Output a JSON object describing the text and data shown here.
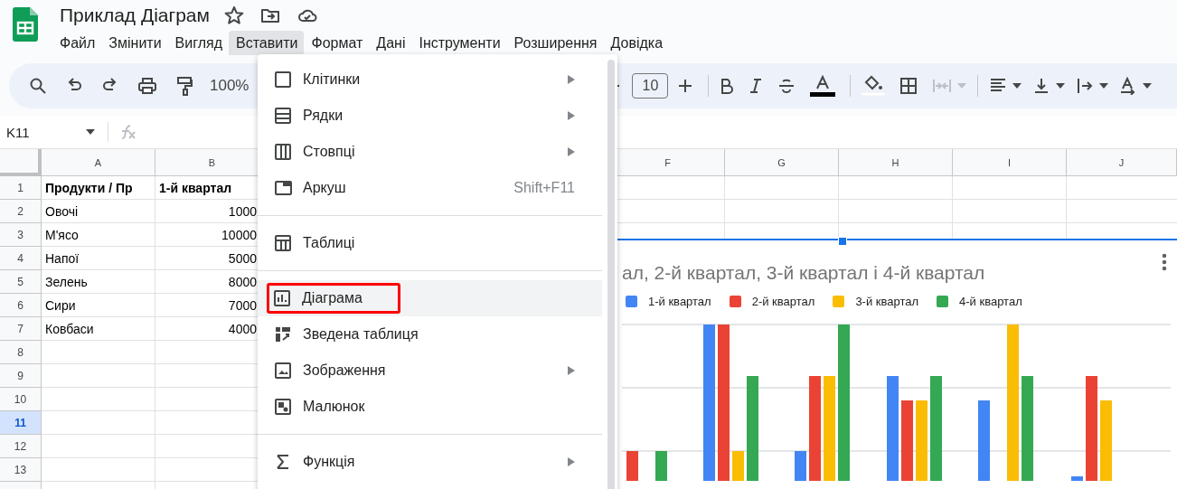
{
  "document": {
    "title": "Приклад Діаграм"
  },
  "menu_bar": [
    {
      "label": "Файл",
      "selected": false
    },
    {
      "label": "Змінити",
      "selected": false
    },
    {
      "label": "Вигляд",
      "selected": false
    },
    {
      "label": "Вставити",
      "selected": true
    },
    {
      "label": "Формат",
      "selected": false
    },
    {
      "label": "Дані",
      "selected": false
    },
    {
      "label": "Інструменти",
      "selected": false
    },
    {
      "label": "Розширення",
      "selected": false
    },
    {
      "label": "Довідка",
      "selected": false
    }
  ],
  "toolbar": {
    "zoom": "100%",
    "font_size": "10",
    "merge_disabled": true
  },
  "formula_bar": {
    "cell_reference": "K11"
  },
  "columns": [
    {
      "label": "A"
    },
    {
      "label": "B"
    },
    {
      "label": "F"
    },
    {
      "label": "G"
    },
    {
      "label": "H"
    },
    {
      "label": "I"
    },
    {
      "label": "J"
    }
  ],
  "rows": [
    {
      "number": "1",
      "selected": false,
      "kind": "header",
      "cells": [
        "Продукти / Пр",
        "1-й квартал"
      ]
    },
    {
      "number": "2",
      "selected": false,
      "kind": "data",
      "cells": [
        "Овочі",
        "1000"
      ]
    },
    {
      "number": "3",
      "selected": false,
      "kind": "data",
      "cells": [
        "М'ясо",
        "10000"
      ]
    },
    {
      "number": "4",
      "selected": false,
      "kind": "data",
      "cells": [
        "Напої",
        "5000"
      ]
    },
    {
      "number": "5",
      "selected": false,
      "kind": "data",
      "cells": [
        "Зелень",
        "8000"
      ]
    },
    {
      "number": "6",
      "selected": false,
      "kind": "data",
      "cells": [
        "Сири",
        "7000"
      ]
    },
    {
      "number": "7",
      "selected": false,
      "kind": "data",
      "cells": [
        "Ковбаси",
        "4000"
      ]
    },
    {
      "number": "8",
      "selected": false,
      "kind": "empty"
    },
    {
      "number": "9",
      "selected": false,
      "kind": "empty"
    },
    {
      "number": "10",
      "selected": false,
      "kind": "empty"
    },
    {
      "number": "11",
      "selected": true,
      "kind": "empty"
    },
    {
      "number": "12",
      "selected": false,
      "kind": "empty"
    },
    {
      "number": "13",
      "selected": false,
      "kind": "empty"
    }
  ],
  "insert_menu": [
    {
      "kind": "item",
      "label": "Клітинки",
      "submenu": true,
      "highlighted": false,
      "outlined": false
    },
    {
      "kind": "item",
      "label": "Рядки",
      "submenu": true,
      "highlighted": false,
      "outlined": false
    },
    {
      "kind": "item",
      "label": "Стовпці",
      "submenu": true,
      "highlighted": false,
      "outlined": false
    },
    {
      "kind": "item",
      "label": "Аркуш",
      "shortcut": "Shift+F11",
      "submenu": false,
      "highlighted": false,
      "outlined": false
    },
    {
      "kind": "divider"
    },
    {
      "kind": "item",
      "label": "Таблиці",
      "submenu": false,
      "highlighted": false,
      "outlined": false
    },
    {
      "kind": "divider"
    },
    {
      "kind": "item",
      "label": "Діаграма",
      "submenu": false,
      "highlighted": true,
      "outlined": true
    },
    {
      "kind": "item",
      "label": "Зведена таблиця",
      "submenu": false,
      "highlighted": false,
      "outlined": false
    },
    {
      "kind": "item",
      "label": "Зображення",
      "submenu": true,
      "highlighted": false,
      "outlined": false
    },
    {
      "kind": "item",
      "label": "Малюнок",
      "submenu": false,
      "highlighted": false,
      "outlined": false
    },
    {
      "kind": "divider"
    },
    {
      "kind": "item",
      "label": "Функція",
      "submenu": true,
      "highlighted": false,
      "outlined": false
    }
  ],
  "chart": {
    "selected": true,
    "title": "ал, 2-й квартал, 3-й квартал і 4-й квартал",
    "legend": [
      {
        "label": "1-й квартал",
        "color": "#4285f4"
      },
      {
        "label": "2-й квартал",
        "color": "#ea4335"
      },
      {
        "label": "3-й квартал",
        "color": "#fbbc04"
      },
      {
        "label": "4-й квартал",
        "color": "#34a853"
      }
    ]
  }
}
